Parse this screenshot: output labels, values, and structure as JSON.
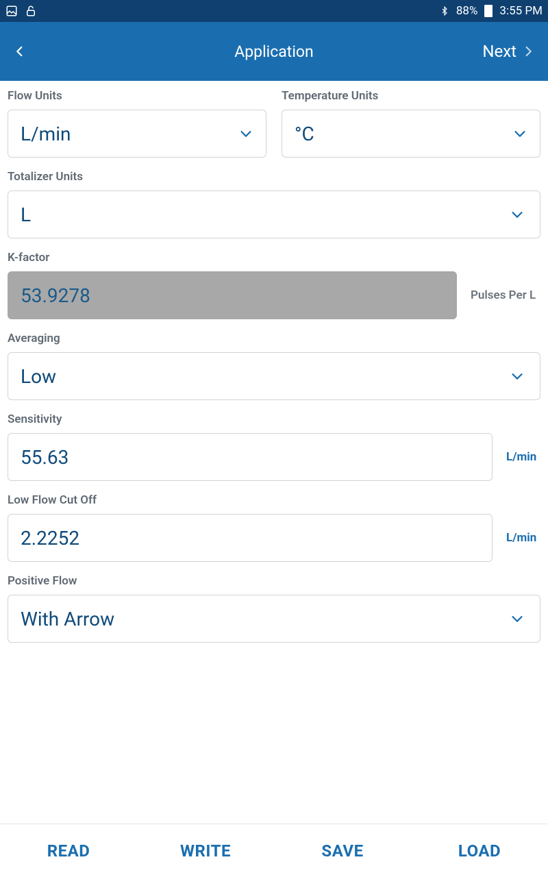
{
  "status": {
    "battery_pct": "88%",
    "time": "3:55 PM"
  },
  "header": {
    "title": "Application",
    "next_label": "Next"
  },
  "form": {
    "flow_units": {
      "label": "Flow Units",
      "value": "L/min"
    },
    "temperature_units": {
      "label": "Temperature Units",
      "value": "°C"
    },
    "totalizer_units": {
      "label": "Totalizer Units",
      "value": "L"
    },
    "k_factor": {
      "label": "K-factor",
      "value": "53.9278",
      "unit": "Pulses Per L"
    },
    "averaging": {
      "label": "Averaging",
      "value": "Low"
    },
    "sensitivity": {
      "label": "Sensitivity",
      "value": "55.63",
      "unit": "L/min"
    },
    "low_flow_cutoff": {
      "label": "Low Flow Cut Off",
      "value": "2.2252",
      "unit": "L/min"
    },
    "positive_flow": {
      "label": "Positive Flow",
      "value": "With Arrow"
    }
  },
  "footer": {
    "read": "READ",
    "write": "WRITE",
    "save": "SAVE",
    "load": "LOAD"
  }
}
